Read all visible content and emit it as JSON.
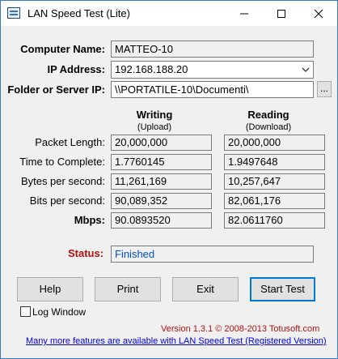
{
  "window": {
    "title": "LAN Speed Test (Lite)"
  },
  "form": {
    "computer_name_label": "Computer Name:",
    "computer_name_value": "MATTEO-10",
    "ip_label": "IP Address:",
    "ip_value": "192.168.188.20",
    "folder_label": "Folder or Server IP:",
    "folder_value": "\\\\PORTATILE-10\\Documenti\\",
    "browse_label": "..."
  },
  "results": {
    "writing_header": "Writing",
    "writing_sub": "(Upload)",
    "reading_header": "Reading",
    "reading_sub": "(Download)",
    "rows": [
      {
        "label": "Packet Length:",
        "writing": "20,000,000",
        "reading": "20,000,000"
      },
      {
        "label": "Time to Complete:",
        "writing": "1.7760145",
        "reading": "1.9497648"
      },
      {
        "label": "Bytes per second:",
        "writing": "11,261,169",
        "reading": "10,257,647"
      },
      {
        "label": "Bits per second:",
        "writing": "90,089,352",
        "reading": "82,061,176"
      },
      {
        "label": "Mbps:",
        "writing": "90.0893520",
        "reading": "82.0611760"
      }
    ]
  },
  "status": {
    "label": "Status:",
    "value": "Finished",
    "color": "#b01010"
  },
  "buttons": {
    "help": "Help",
    "print": "Print",
    "exit": "Exit",
    "start": "Start Test"
  },
  "footer": {
    "log_window_label": "Log Window",
    "log_window_checked": false,
    "version": "Version 1.3.1 © 2008-2013 Totusoft.com",
    "promo_link": "Many more features are available with LAN Speed Test (Registered Version)"
  },
  "icons": [
    "app-icon",
    "minimize-icon",
    "maximize-icon",
    "close-icon",
    "chevron-down-icon"
  ]
}
